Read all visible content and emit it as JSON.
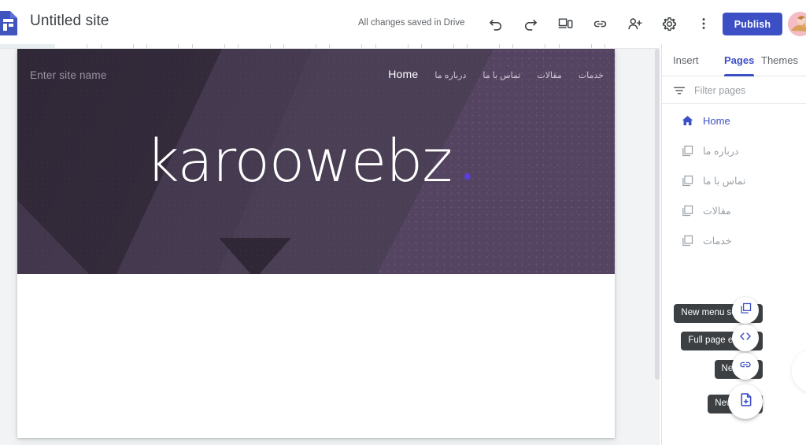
{
  "topbar": {
    "logo_icon": "google-sites-logo-icon",
    "site_title": "Untitled site",
    "save_status": "All changes saved in Drive",
    "icons": [
      {
        "name": "undo-icon",
        "label": "Undo"
      },
      {
        "name": "redo-icon",
        "label": "Redo"
      },
      {
        "name": "preview-icon",
        "label": "Preview"
      },
      {
        "name": "copy-link-icon",
        "label": "Copy published site link"
      },
      {
        "name": "share-with-others-icon",
        "label": "Share with others"
      },
      {
        "name": "settings-gear-icon",
        "label": "Settings"
      },
      {
        "name": "more-options-icon",
        "label": "More"
      }
    ],
    "publish_label": "Publish",
    "avatar_label": "Account"
  },
  "banner": {
    "site_name_placeholder": "Enter site name",
    "title": "karoowebz",
    "accent_dot_color": "#5b3de0",
    "bg_color": "#473b52",
    "bg_dark_color": "#352c3d",
    "bg_light_color": "#554461",
    "nav": [
      {
        "label": "Home",
        "active": true,
        "rtl": false
      },
      {
        "label": "درباره ما",
        "active": false,
        "rtl": true
      },
      {
        "label": "تماس با ما",
        "active": false,
        "rtl": true
      },
      {
        "label": "مقالات",
        "active": false,
        "rtl": true
      },
      {
        "label": "خدمات",
        "active": false,
        "rtl": true
      }
    ]
  },
  "right_panel": {
    "tabs": [
      {
        "label": "Insert",
        "active": false
      },
      {
        "label": "Pages",
        "active": true
      },
      {
        "label": "Themes",
        "active": false
      }
    ],
    "accent_color": "#3c4fc4",
    "filter": {
      "icon": "filter-icon",
      "placeholder": "Filter pages"
    },
    "pages": [
      {
        "label": "Home",
        "icon": "home-icon",
        "active": true
      },
      {
        "label": "درباره ما",
        "icon": "page-icon",
        "active": false
      },
      {
        "label": "تماس با ما",
        "icon": "page-icon",
        "active": false
      },
      {
        "label": "مقالات",
        "icon": "page-icon",
        "active": false
      },
      {
        "label": "خدمات",
        "icon": "page-icon",
        "active": false
      }
    ]
  },
  "fabs": [
    {
      "tooltip": "New menu section",
      "icon": "new-menu-section-icon",
      "size": "small"
    },
    {
      "tooltip": "Full page embed",
      "icon": "code-embed-icon",
      "size": "small"
    },
    {
      "tooltip": "New link",
      "icon": "link-icon",
      "size": "small"
    },
    {
      "tooltip": "New page",
      "icon": "new-page-icon",
      "size": "big"
    }
  ]
}
